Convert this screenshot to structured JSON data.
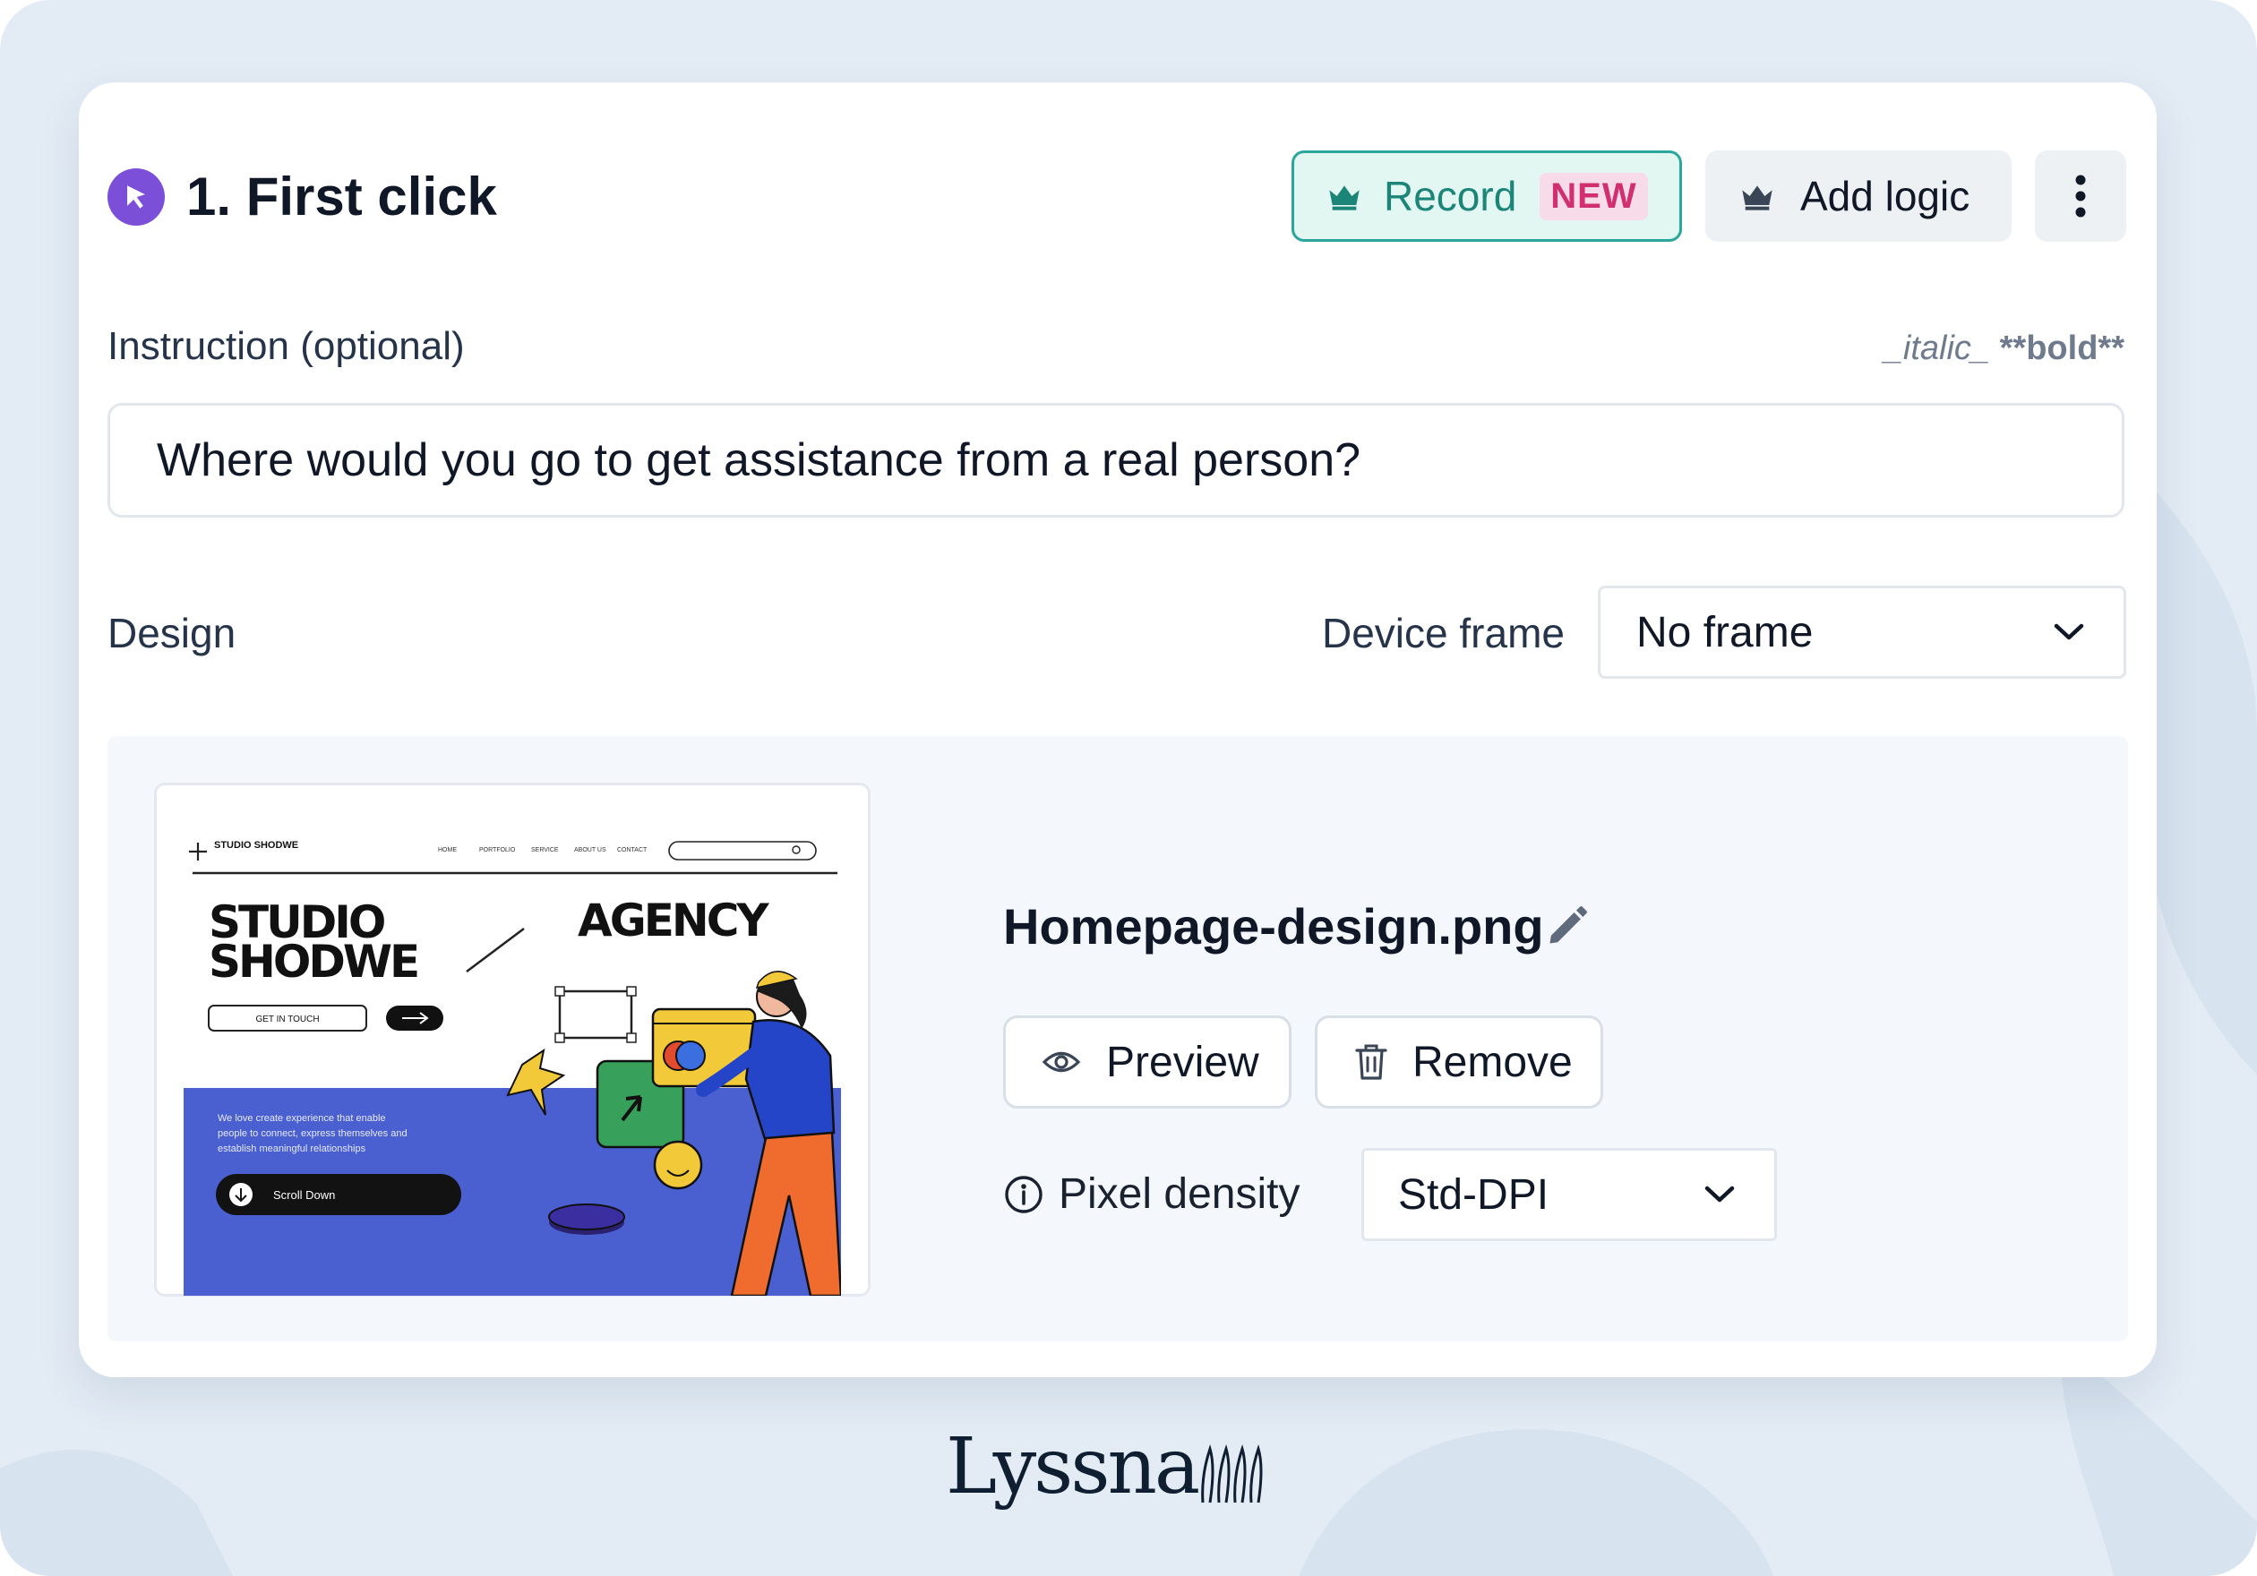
{
  "step": {
    "title": "1. First click",
    "icon": "cursor-click-icon",
    "accent": "#7b4fd8"
  },
  "header_actions": {
    "record_label": "Record",
    "record_badge": "NEW",
    "add_logic_label": "Add logic",
    "crown_icon": "crown-icon",
    "more_icon": "more-vertical-icon"
  },
  "instruction": {
    "label": "Instruction (optional)",
    "markdown_italic": "_italic_",
    "markdown_bold": "**bold**",
    "value": "Where would you go to get assistance from a real person?"
  },
  "design": {
    "label": "Design",
    "device_frame_label": "Device frame",
    "device_frame_value": "No frame",
    "file_name": "Homepage-design.png",
    "preview_label": "Preview",
    "remove_label": "Remove",
    "pixel_density_label": "Pixel density",
    "pixel_density_value": "Std-DPI"
  },
  "thumbnail": {
    "brand": "STUDIO SHODWE",
    "nav": [
      "HOME",
      "PORTFOLIO",
      "SERVICE",
      "ABOUT US",
      "CONTACT"
    ],
    "headline_line1": "STUDIO",
    "headline_line2": "SHODWE",
    "headline_right": "AGENCY",
    "cta": "GET IN TOUCH",
    "body_line1": "We love create experience that enable",
    "body_line2": "people to connect, express themselves and",
    "body_line3": "establish meaningful relationships",
    "scroll_label": "Scroll Down",
    "hero_color": "#4a5fd0"
  },
  "footer": {
    "logo_text": "Lyssna"
  },
  "colors": {
    "record_border": "#2aa79a",
    "record_bg": "#e2f6f2",
    "badge_bg": "#f8dbe9",
    "badge_text": "#d0306f",
    "page_bg": "#e3ecf5"
  }
}
